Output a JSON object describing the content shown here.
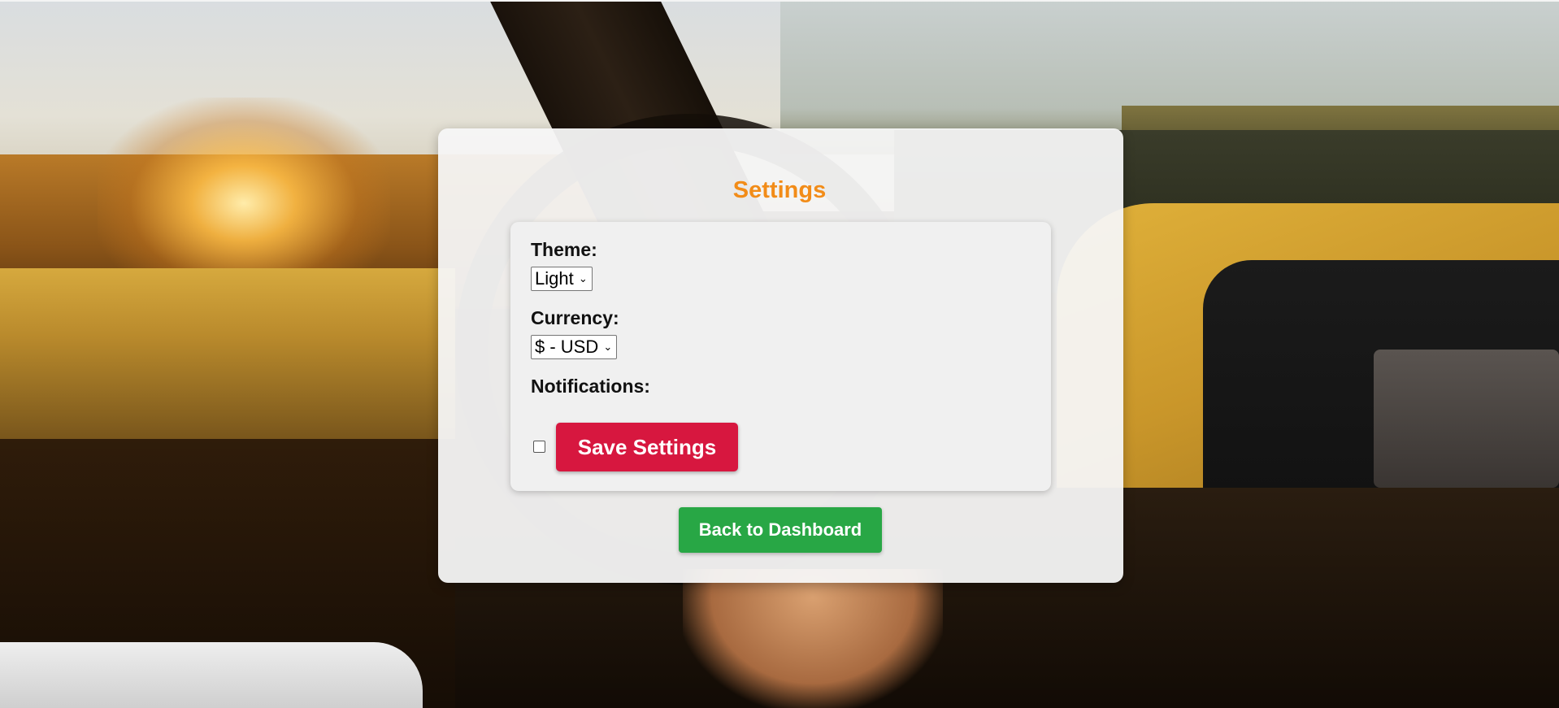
{
  "settings": {
    "title": "Settings",
    "theme": {
      "label": "Theme:",
      "selected": "Light"
    },
    "currency": {
      "label": "Currency:",
      "selected": "$ - USD"
    },
    "notifications": {
      "label": "Notifications:",
      "checked": false
    },
    "save_label": "Save Settings",
    "back_label": "Back to Dashboard"
  },
  "colors": {
    "title": "#f28c18",
    "save_button": "#d7173f",
    "back_button": "#28a745"
  }
}
